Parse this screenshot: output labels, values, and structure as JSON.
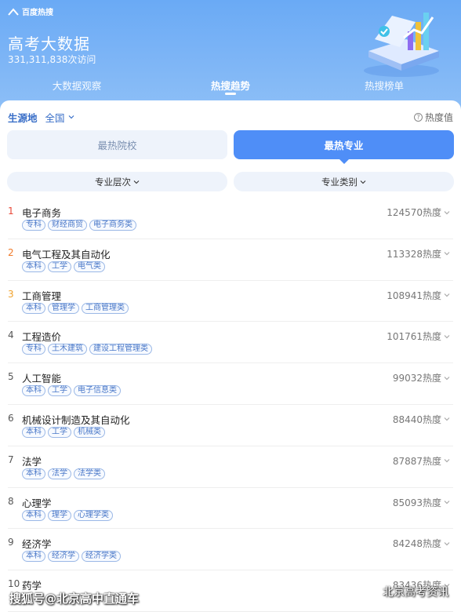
{
  "header": {
    "brand": "百度热搜",
    "title": "高考大数据",
    "visits": "331,311,838次访问",
    "nav": [
      "大数据观察",
      "热搜趋势",
      "热搜榜单"
    ],
    "active_nav": 1
  },
  "filters": {
    "label": "生源地",
    "value": "全国",
    "heat_help": "热度值"
  },
  "segments": [
    "最热院校",
    "最热专业"
  ],
  "active_segment": 1,
  "sub_filters": [
    "专业层次",
    "专业类别"
  ],
  "items": [
    {
      "rank": "1",
      "name": "电子商务",
      "tags": [
        "专科",
        "财经商贸",
        "电子商务类"
      ],
      "heat": "124570热度"
    },
    {
      "rank": "2",
      "name": "电气工程及其自动化",
      "tags": [
        "本科",
        "工学",
        "电气类"
      ],
      "heat": "113328热度"
    },
    {
      "rank": "3",
      "name": "工商管理",
      "tags": [
        "本科",
        "管理学",
        "工商管理类"
      ],
      "heat": "108941热度"
    },
    {
      "rank": "4",
      "name": "工程造价",
      "tags": [
        "专科",
        "土木建筑",
        "建设工程管理类"
      ],
      "heat": "101761热度"
    },
    {
      "rank": "5",
      "name": "人工智能",
      "tags": [
        "本科",
        "工学",
        "电子信息类"
      ],
      "heat": "99032热度"
    },
    {
      "rank": "6",
      "name": "机械设计制造及其自动化",
      "tags": [
        "本科",
        "工学",
        "机械类"
      ],
      "heat": "88440热度"
    },
    {
      "rank": "7",
      "name": "法学",
      "tags": [
        "本科",
        "法学",
        "法学类"
      ],
      "heat": "87887热度"
    },
    {
      "rank": "8",
      "name": "心理学",
      "tags": [
        "本科",
        "理学",
        "心理学类"
      ],
      "heat": "85093热度"
    },
    {
      "rank": "9",
      "name": "经济学",
      "tags": [
        "本科",
        "经济学",
        "经济学类"
      ],
      "heat": "84248热度"
    },
    {
      "rank": "10",
      "name": "药学",
      "tags": [],
      "heat": "83436热度"
    }
  ],
  "watermark_left": "搜狐号@北京高中直通车",
  "watermark_right": "北京高考资讯"
}
